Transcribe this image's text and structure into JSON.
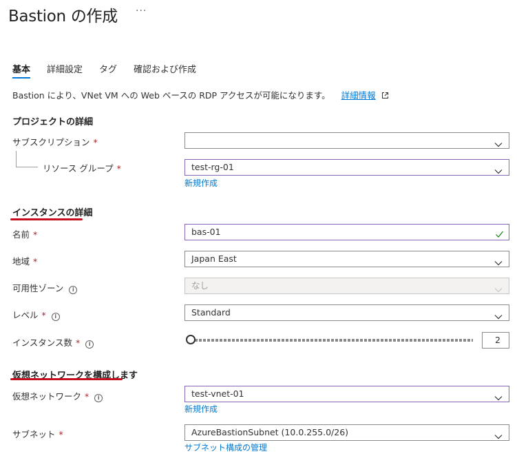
{
  "header": {
    "title": "Bastion の作成",
    "more": "···"
  },
  "tabs": [
    {
      "label": "基本"
    },
    {
      "label": "詳細設定"
    },
    {
      "label": "タグ"
    },
    {
      "label": "確認および作成"
    }
  ],
  "description": {
    "text": "Bastion により、VNet VM への Web ベースの RDP アクセスが可能になります。",
    "link": "詳細情報"
  },
  "project": {
    "heading": "プロジェクトの詳細",
    "subscription": {
      "label": "サブスクリプション",
      "value": ""
    },
    "resource_group": {
      "label": "リソース グループ",
      "value": "test-rg-01",
      "create_new": "新規作成"
    }
  },
  "instance": {
    "heading": "インスタンスの詳細",
    "name": {
      "label": "名前",
      "value": "bas-01"
    },
    "region": {
      "label": "地域",
      "value": "Japan East"
    },
    "availability_zone": {
      "label": "可用性ゾーン",
      "value": "なし"
    },
    "tier": {
      "label": "レベル",
      "value": "Standard"
    },
    "instance_count": {
      "label": "インスタンス数",
      "value": "2"
    }
  },
  "network": {
    "heading": "仮想ネットワークを構成します",
    "vnet": {
      "label": "仮想ネットワーク",
      "value": "test-vnet-01",
      "create_new": "新規作成"
    },
    "subnet": {
      "label": "サブネット",
      "value": "AzureBastionSubnet (10.0.255.0/26)",
      "manage": "サブネット構成の管理"
    }
  },
  "required_mark": "*",
  "info_glyph": "i",
  "colors": {
    "accent": "#0078d4",
    "required": "#a4262c",
    "focus_border": "#8764b8",
    "annotation": "#c50f1f",
    "valid": "#107c10"
  }
}
